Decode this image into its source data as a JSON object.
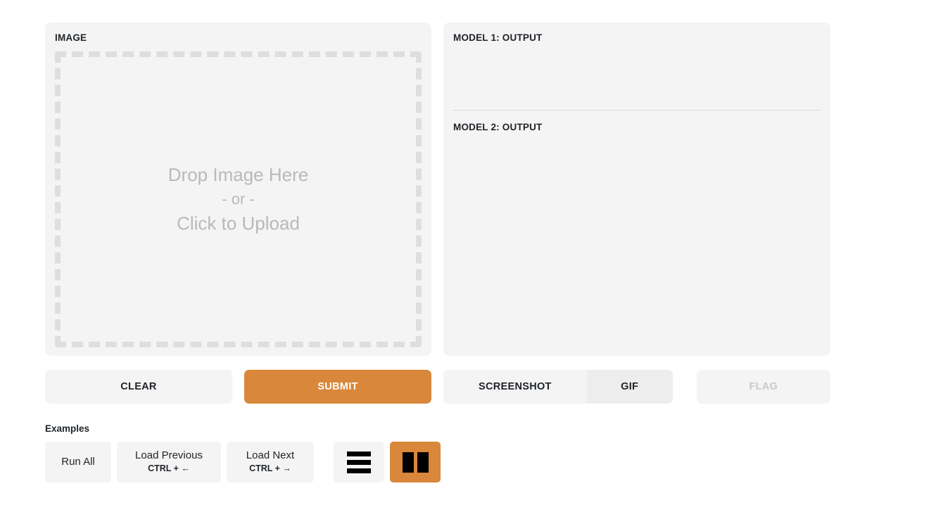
{
  "image_panel": {
    "label": "IMAGE",
    "dropzone": {
      "line1": "Drop Image Here",
      "line2": "- or -",
      "line3": "Click to Upload"
    }
  },
  "output_panel": {
    "model1_label": "MODEL 1: OUTPUT",
    "model1_text": "",
    "model2_label": "MODEL 2: OUTPUT",
    "model2_text": ""
  },
  "actions": {
    "clear": "CLEAR",
    "submit": "SUBMIT",
    "screenshot": "SCREENSHOT",
    "gif": "GIF",
    "flag": "FLAG"
  },
  "examples": {
    "title": "Examples",
    "run_all": "Run All",
    "load_previous": {
      "label": "Load Previous",
      "shortcut": "CTRL + ←"
    },
    "load_next": {
      "label": "Load Next",
      "shortcut": "CTRL + →"
    },
    "views": [
      {
        "name": "list-view",
        "active": false
      },
      {
        "name": "gallery-view",
        "active": true
      }
    ]
  },
  "colors": {
    "accent": "#d9873a",
    "panel": "#f4f4f4",
    "button": "#f4f4f4",
    "button_active": "#ededed",
    "disabled_text": "#c8c8c8",
    "dashed_border": "#dedede",
    "placeholder_text": "#b9b9b9"
  }
}
